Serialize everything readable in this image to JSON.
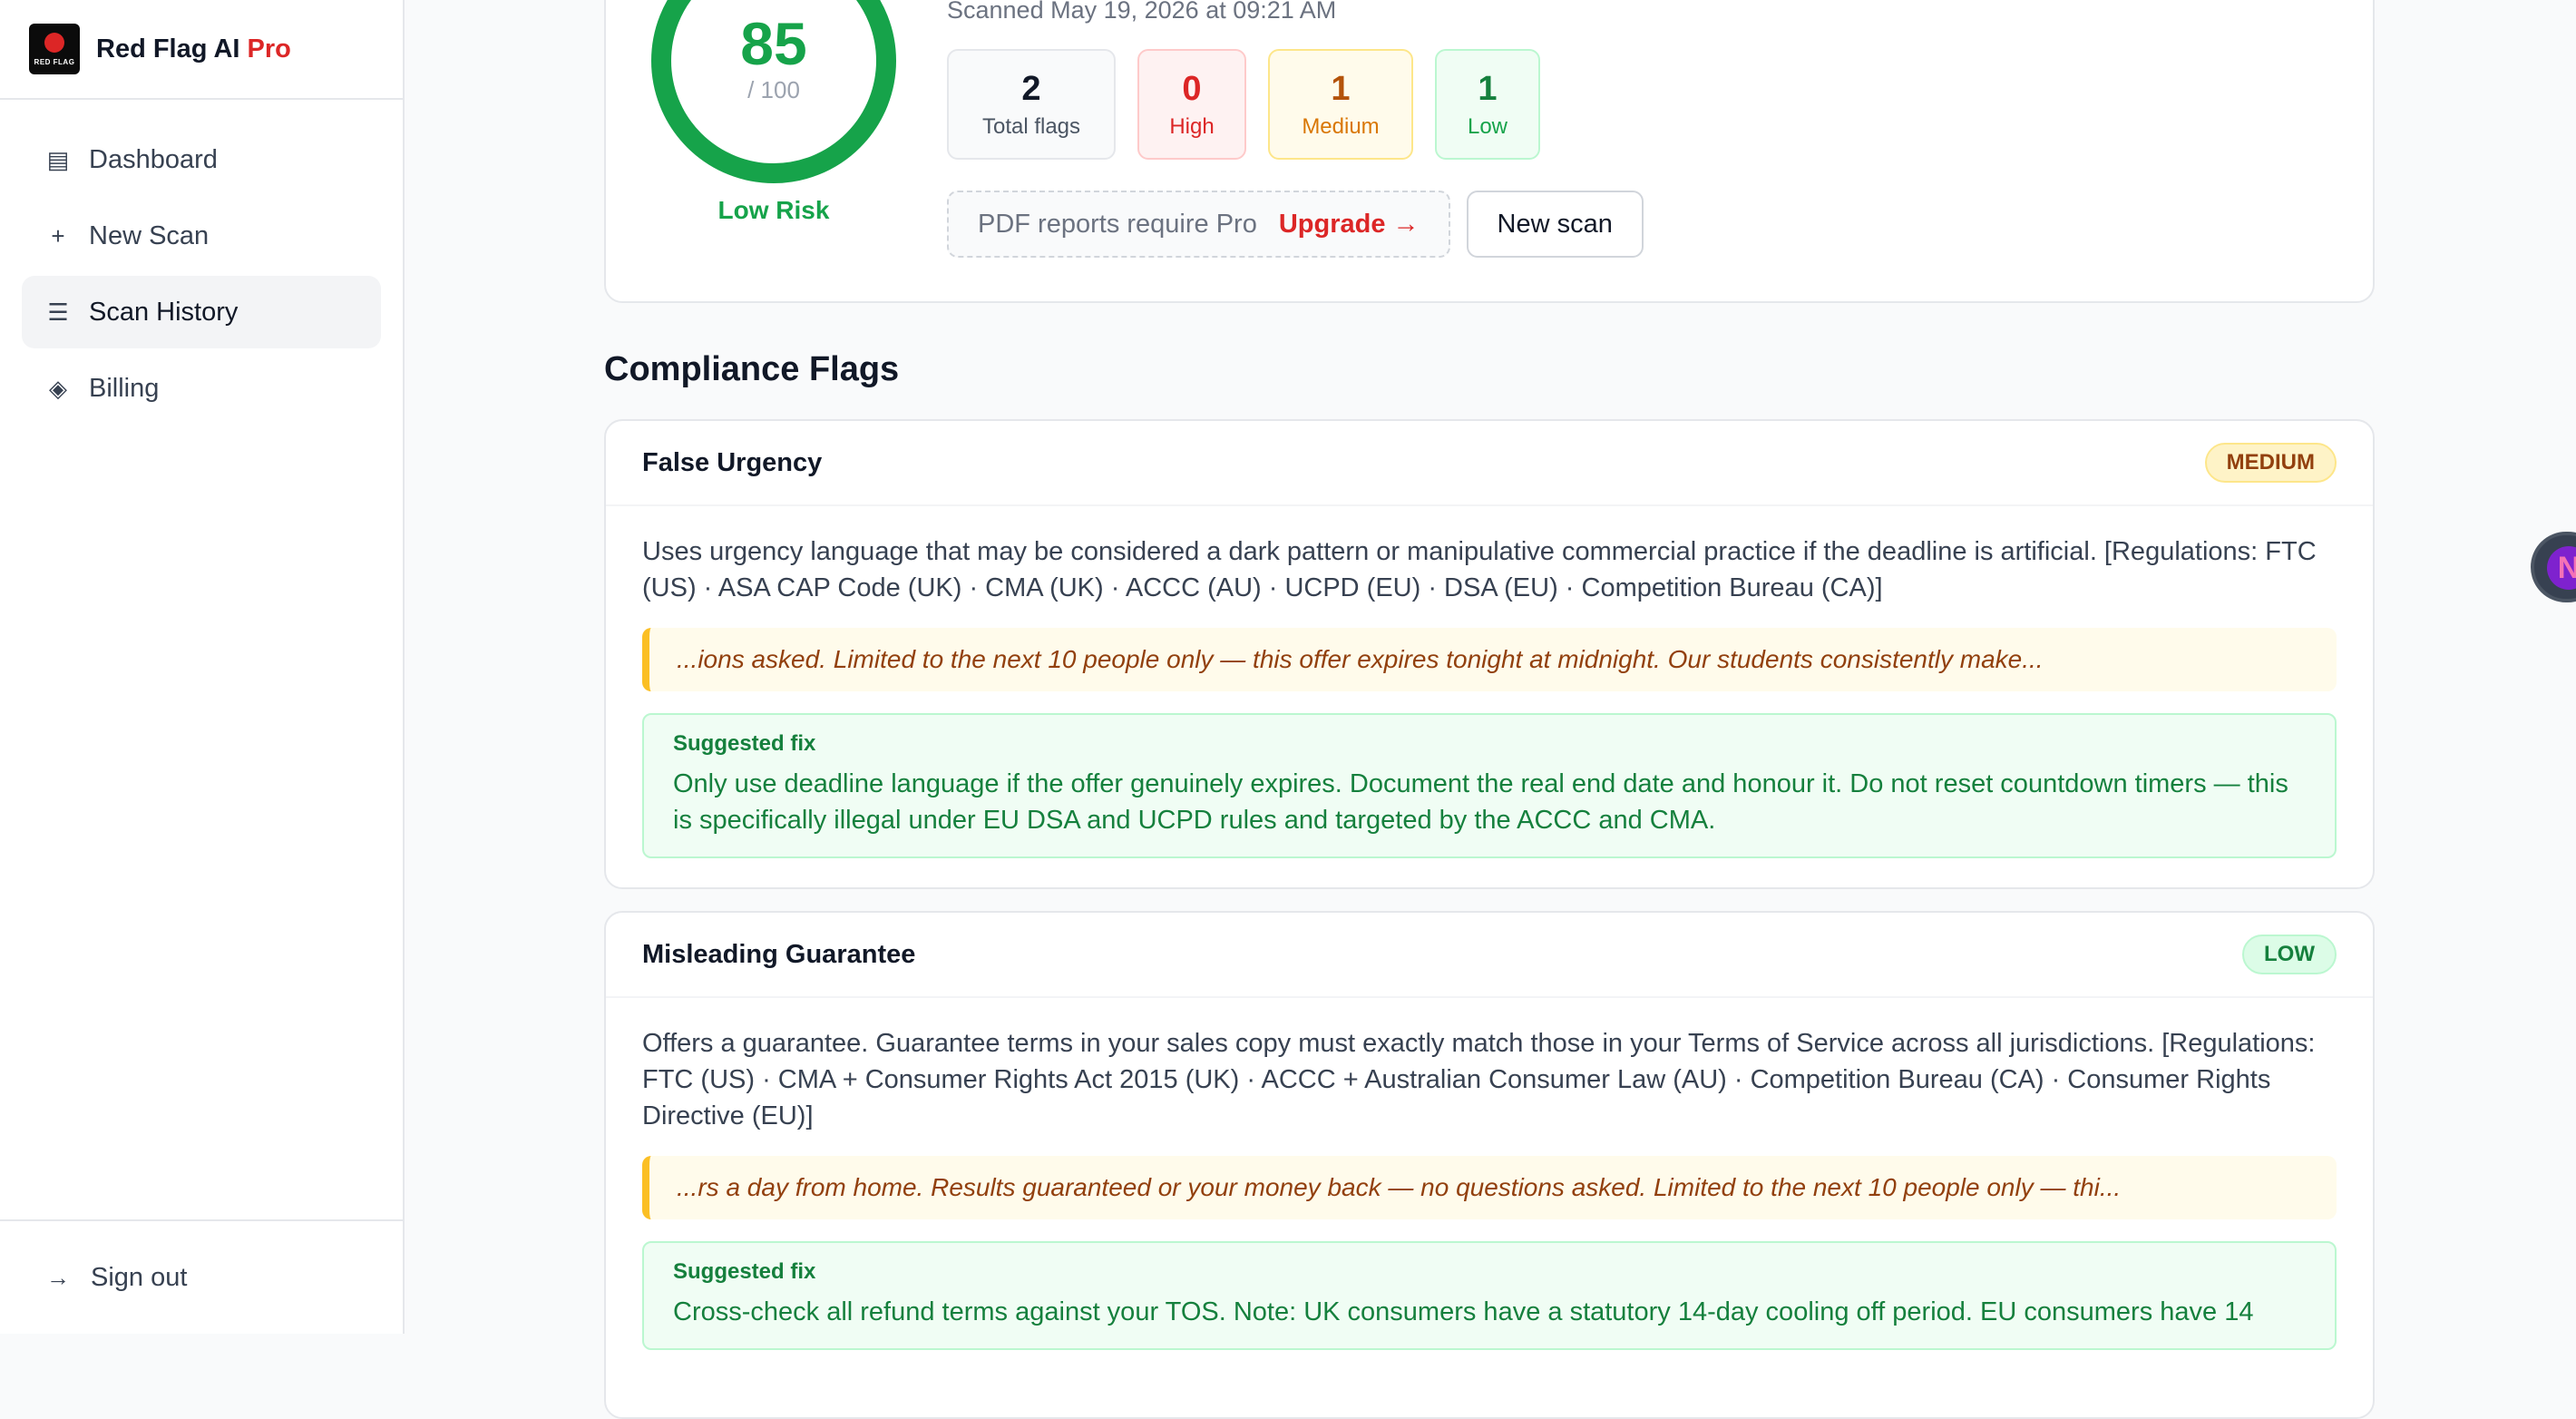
{
  "brand": {
    "name": "Red Flag AI",
    "pro": "Pro",
    "logo_text": "RED FLAG"
  },
  "sidebar": {
    "items": [
      {
        "icon": "▤",
        "label": "Dashboard"
      },
      {
        "icon": "+",
        "label": "New Scan"
      },
      {
        "icon": "☰",
        "label": "Scan History"
      },
      {
        "icon": "◈",
        "label": "Billing"
      }
    ],
    "active_index": 2,
    "sign_out": {
      "icon": "→",
      "label": "Sign out"
    }
  },
  "score": {
    "value": "85",
    "max": "/ 100",
    "risk": "Low Risk",
    "color": "#16a34a",
    "percent": 100
  },
  "scanned_text": "Scanned May 19, 2026 at 09:21 AM",
  "stats": {
    "total": {
      "num": "2",
      "label": "Total flags"
    },
    "high": {
      "num": "0",
      "label": "High"
    },
    "medium": {
      "num": "1",
      "label": "Medium"
    },
    "low": {
      "num": "1",
      "label": "Low"
    }
  },
  "actions": {
    "pdf_note": "PDF reports require Pro",
    "upgrade": "Upgrade →",
    "new_scan": "New scan"
  },
  "section_title": "Compliance Flags",
  "flags": [
    {
      "title": "False Urgency",
      "severity": "MEDIUM",
      "description": "Uses urgency language that may be considered a dark pattern or manipulative commercial practice if the deadline is artificial. [Regulations: FTC (US) · ASA CAP Code (UK) · CMA (UK) · ACCC (AU) · UCPD (EU) · DSA (EU) · Competition Bureau (CA)]",
      "quote": "...ions asked. Limited to the next 10 people only — this offer expires tonight at midnight. Our students consistently make...",
      "fix_title": "Suggested fix",
      "fix_text": "Only use deadline language if the offer genuinely expires. Document the real end date and honour it. Do not reset countdown timers — this is specifically illegal under EU DSA and UCPD rules and targeted by the ACCC and CMA."
    },
    {
      "title": "Misleading Guarantee",
      "severity": "LOW",
      "description": "Offers a guarantee. Guarantee terms in your sales copy must exactly match those in your Terms of Service across all jurisdictions. [Regulations: FTC (US) · CMA + Consumer Rights Act 2015 (UK) · ACCC + Australian Consumer Law (AU) · Competition Bureau (CA) · Consumer Rights Directive (EU)]",
      "quote": "...rs a day from home. Results guaranteed or your money back — no questions asked. Limited to the next 10 people only — thi...",
      "fix_title": "Suggested fix",
      "fix_text": "Cross-check all refund terms against your TOS. Note: UK consumers have a statutory 14-day cooling off period. EU consumers have 14"
    }
  ],
  "floating_avatar": {
    "letter": "N"
  }
}
